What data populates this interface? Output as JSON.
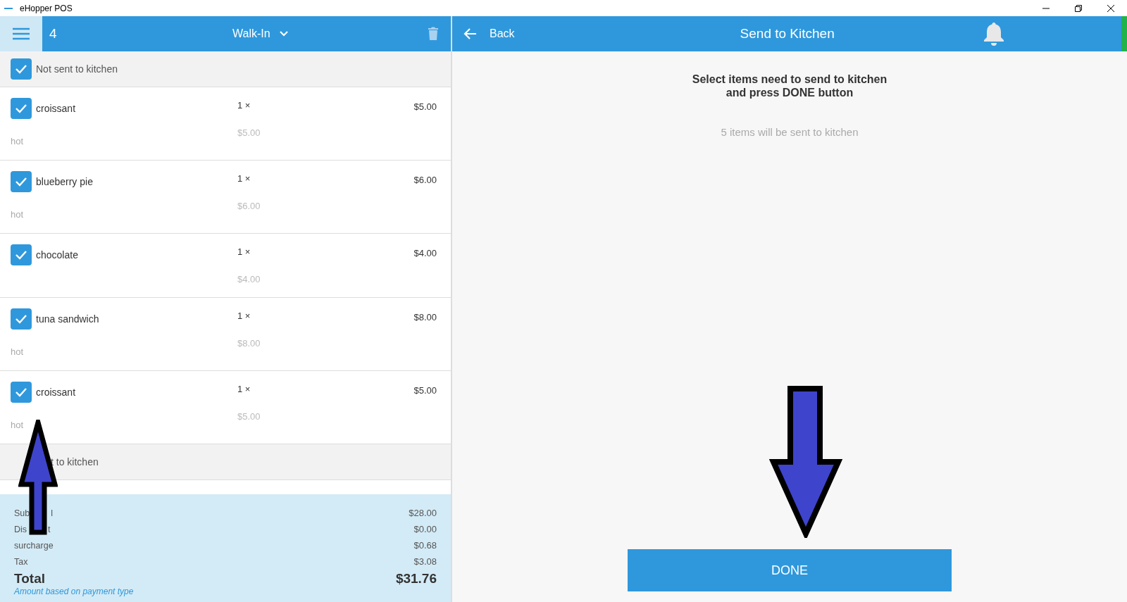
{
  "window": {
    "title": "eHopper POS"
  },
  "order": {
    "number": "4",
    "customer": "Walk-In"
  },
  "groups": [
    {
      "label": "Not sent to kitchen",
      "checked": true,
      "items": [
        {
          "name": "croissant",
          "checked": true,
          "quantity": "1 ×",
          "price": "$5.00",
          "unit_price": "$5.00",
          "note": "hot"
        },
        {
          "name": "blueberry pie",
          "checked": true,
          "quantity": "1 ×",
          "price": "$6.00",
          "unit_price": "$6.00",
          "note": "hot"
        },
        {
          "name": "chocolate",
          "checked": true,
          "quantity": "1 ×",
          "price": "$4.00",
          "unit_price": "$4.00"
        },
        {
          "name": "tuna sandwich",
          "checked": true,
          "quantity": "1 ×",
          "price": "$8.00",
          "unit_price": "$8.00",
          "note": "hot"
        },
        {
          "name": "croissant",
          "checked": true,
          "quantity": "1 ×",
          "price": "$5.00",
          "unit_price": "$5.00",
          "note": "hot"
        }
      ]
    },
    {
      "label": "t to kitchen"
    }
  ],
  "summary": [
    {
      "label_parts": [
        "Sub",
        "l"
      ],
      "value": "$28.00"
    },
    {
      "label_parts": [
        "Dis",
        "t"
      ],
      "value": "$0.00"
    },
    {
      "label_parts": [
        "surcharge"
      ],
      "value": "$0.68"
    },
    {
      "label_parts": [
        "Tax"
      ],
      "value": "$3.08"
    }
  ],
  "total": {
    "label": "Total",
    "value": "$31.76",
    "note": "Amount based on payment type"
  },
  "panel": {
    "back": "Back",
    "title": "Send to Kitchen",
    "instruction_lines": [
      "Select items need to send to kitchen",
      "and press DONE button"
    ],
    "status": "5 items will be sent to kitchen",
    "button": "DONE"
  }
}
